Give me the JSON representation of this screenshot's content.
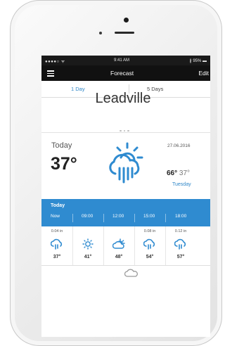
{
  "statusbar": {
    "signal": "●●●●○ ᯤ",
    "time": "9:41 AM",
    "battery": "∦ 95% ▬"
  },
  "navbar": {
    "title": "Forecast",
    "edit_label": "Edit"
  },
  "tabs": [
    {
      "label": "1 Day",
      "active": true
    },
    {
      "label": "5 Days",
      "active": false
    }
  ],
  "location": {
    "city": "Leadville"
  },
  "today": {
    "label": "Today",
    "temperature": "37°",
    "date": "27.06.2016",
    "high": "66°",
    "low": "37°",
    "weekday": "Tuesday",
    "icon": "partly-cloudy-rain-icon"
  },
  "hourly": {
    "section_label": "Today",
    "columns": [
      "Now",
      "09:00",
      "12:00",
      "15:00",
      "18:00"
    ],
    "items": [
      {
        "rain": "0.04 in",
        "icon": "rain-icon",
        "temp": "37°"
      },
      {
        "rain": "",
        "icon": "sun-icon",
        "temp": "41°"
      },
      {
        "rain": "",
        "icon": "partly-cloudy-icon",
        "temp": "48°"
      },
      {
        "rain": "0.08 in",
        "icon": "rain-icon",
        "temp": "54°"
      },
      {
        "rain": "0.12 in",
        "icon": "rain-icon",
        "temp": "57°"
      }
    ]
  },
  "colors": {
    "accent": "#2f8bd0",
    "navbar": "#111111",
    "status_bar": "#1a1a1a"
  }
}
